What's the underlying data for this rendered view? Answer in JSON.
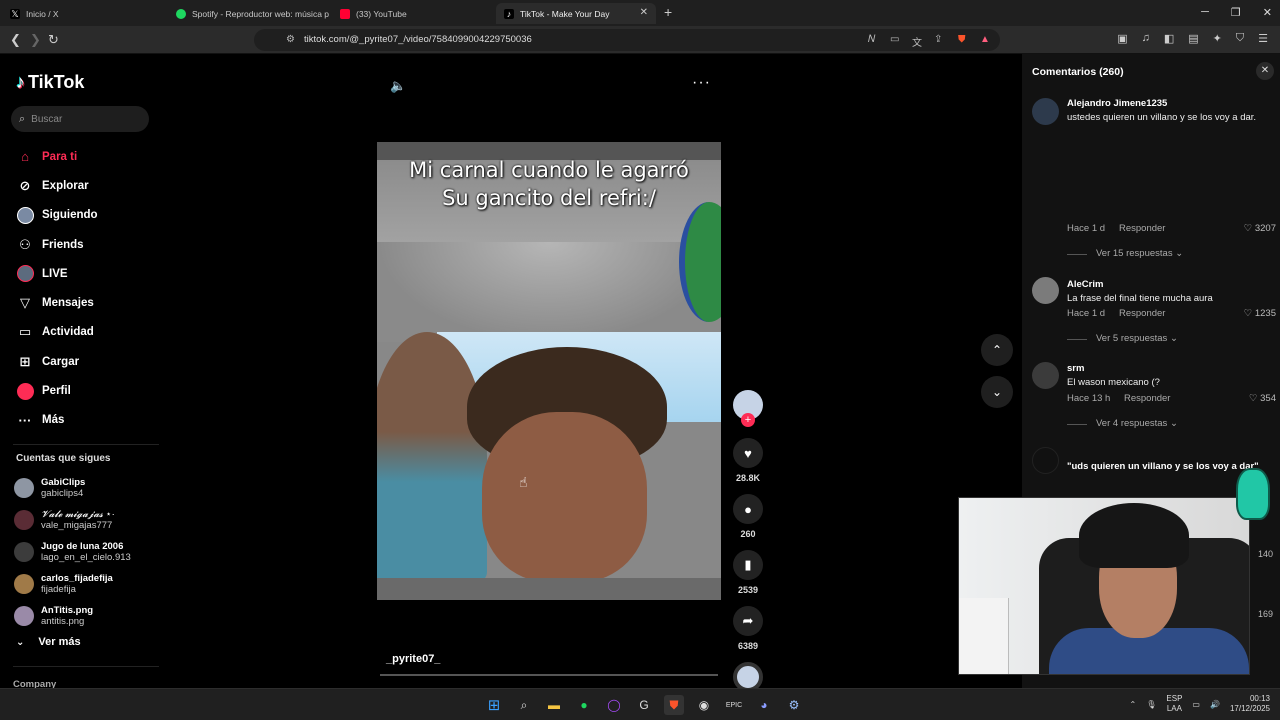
{
  "browser": {
    "tabs": [
      {
        "label": "Inicio / X",
        "icon": "x-icon"
      },
      {
        "label": "Spotify - Reproductor web: música p",
        "icon": "spotify-icon"
      },
      {
        "label": "(33) YouTube",
        "icon": "youtube-icon"
      },
      {
        "label": "TikTok - Make Your Day",
        "icon": "tiktok-icon"
      }
    ],
    "url": "tiktok.com/@_pyrite07_/video/7584099004229750036"
  },
  "sidebar": {
    "logo": "TikTok",
    "search_placeholder": "Buscar",
    "nav": [
      {
        "label": "Para ti",
        "icon": "home-icon"
      },
      {
        "label": "Explorar",
        "icon": "compass-icon"
      },
      {
        "label": "Siguiendo",
        "icon": "following-avatar-icon"
      },
      {
        "label": "Friends",
        "icon": "friends-icon"
      },
      {
        "label": "LIVE",
        "icon": "live-icon"
      },
      {
        "label": "Mensajes",
        "icon": "send-icon"
      },
      {
        "label": "Actividad",
        "icon": "activity-icon"
      },
      {
        "label": "Cargar",
        "icon": "upload-icon"
      },
      {
        "label": "Perfil",
        "icon": "profile-icon"
      },
      {
        "label": "Más",
        "icon": "more-icon"
      }
    ],
    "following_title": "Cuentas que sigues",
    "following": [
      {
        "name": "GabiClips",
        "user": "gabiclips4"
      },
      {
        "name": "𝓥𝓪𝓵𝓮 𝓶𝓲𝓰𝓪𝓳𝓪𝓼 ⋆·",
        "user": "vale_migajas777"
      },
      {
        "name": "Jugo de luna 2006",
        "user": "lago_en_el_cielo.913"
      },
      {
        "name": "carlos_fijadefija",
        "user": "fijadefija"
      },
      {
        "name": "AnTitis.png",
        "user": "antitis.png"
      }
    ],
    "ver_mas": "Ver más",
    "company": "Company"
  },
  "video": {
    "caption_line1": "Mi carnal cuando le agarró",
    "caption_line2": "Su gancito del refri:/",
    "author": "_pyrite07_",
    "likes": "28.8K",
    "comments": "260",
    "saves": "2539",
    "shares": "6389"
  },
  "comments": {
    "title": "Comentarios (260)",
    "reply_label": "Responder",
    "items": [
      {
        "name": "Alejandro Jimene1235",
        "text": "ustedes quieren un villano y se los voy a dar.",
        "time": "Hace 1 d",
        "likes": "3207",
        "replies": "Ver 15 respuestas"
      },
      {
        "name": "AleCrim",
        "text": "La frase del final tiene mucha aura",
        "time": "Hace 1 d",
        "likes": "1235",
        "replies": "Ver 5 respuestas"
      },
      {
        "name": "srm",
        "text": "El wason mexicano (?",
        "time": "Hace 13 h",
        "likes": "354",
        "replies": "Ver 4 respuestas"
      }
    ],
    "quote": "\"uds quieren un villano y se los voy a dar\"",
    "hidden_counts": [
      "140",
      "169"
    ]
  },
  "taskbar": {
    "lang1": "ESP",
    "lang2": "LAA",
    "time": "00:13",
    "date": "17/12/2025"
  }
}
